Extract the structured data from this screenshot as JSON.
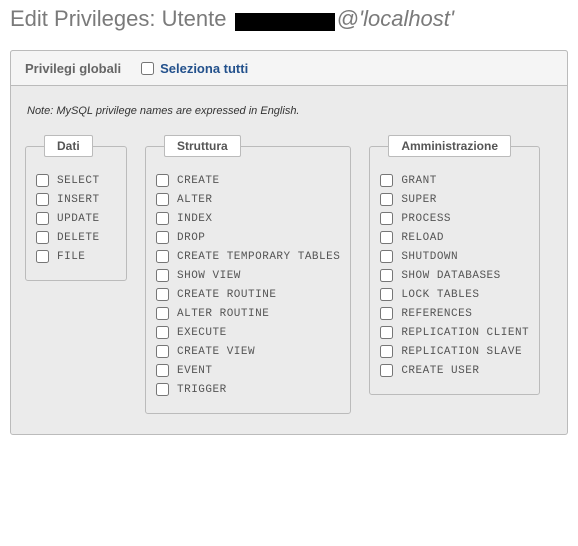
{
  "title_prefix": "Edit Privileges: Utente ",
  "title_host": "@'localhost'",
  "tab": {
    "label": "Privilegi globali",
    "select_all": "Seleziona tutti"
  },
  "note": "Note: MySQL privilege names are expressed in English.",
  "groups": {
    "dati": {
      "title": "Dati",
      "items": [
        "SELECT",
        "INSERT",
        "UPDATE",
        "DELETE",
        "FILE"
      ]
    },
    "struttura": {
      "title": "Struttura",
      "items": [
        "CREATE",
        "ALTER",
        "INDEX",
        "DROP",
        "CREATE TEMPORARY TABLES",
        "SHOW VIEW",
        "CREATE ROUTINE",
        "ALTER ROUTINE",
        "EXECUTE",
        "CREATE VIEW",
        "EVENT",
        "TRIGGER"
      ]
    },
    "amministrazione": {
      "title": "Amministrazione",
      "items": [
        "GRANT",
        "SUPER",
        "PROCESS",
        "RELOAD",
        "SHUTDOWN",
        "SHOW DATABASES",
        "LOCK TABLES",
        "REFERENCES",
        "REPLICATION CLIENT",
        "REPLICATION SLAVE",
        "CREATE USER"
      ]
    }
  }
}
